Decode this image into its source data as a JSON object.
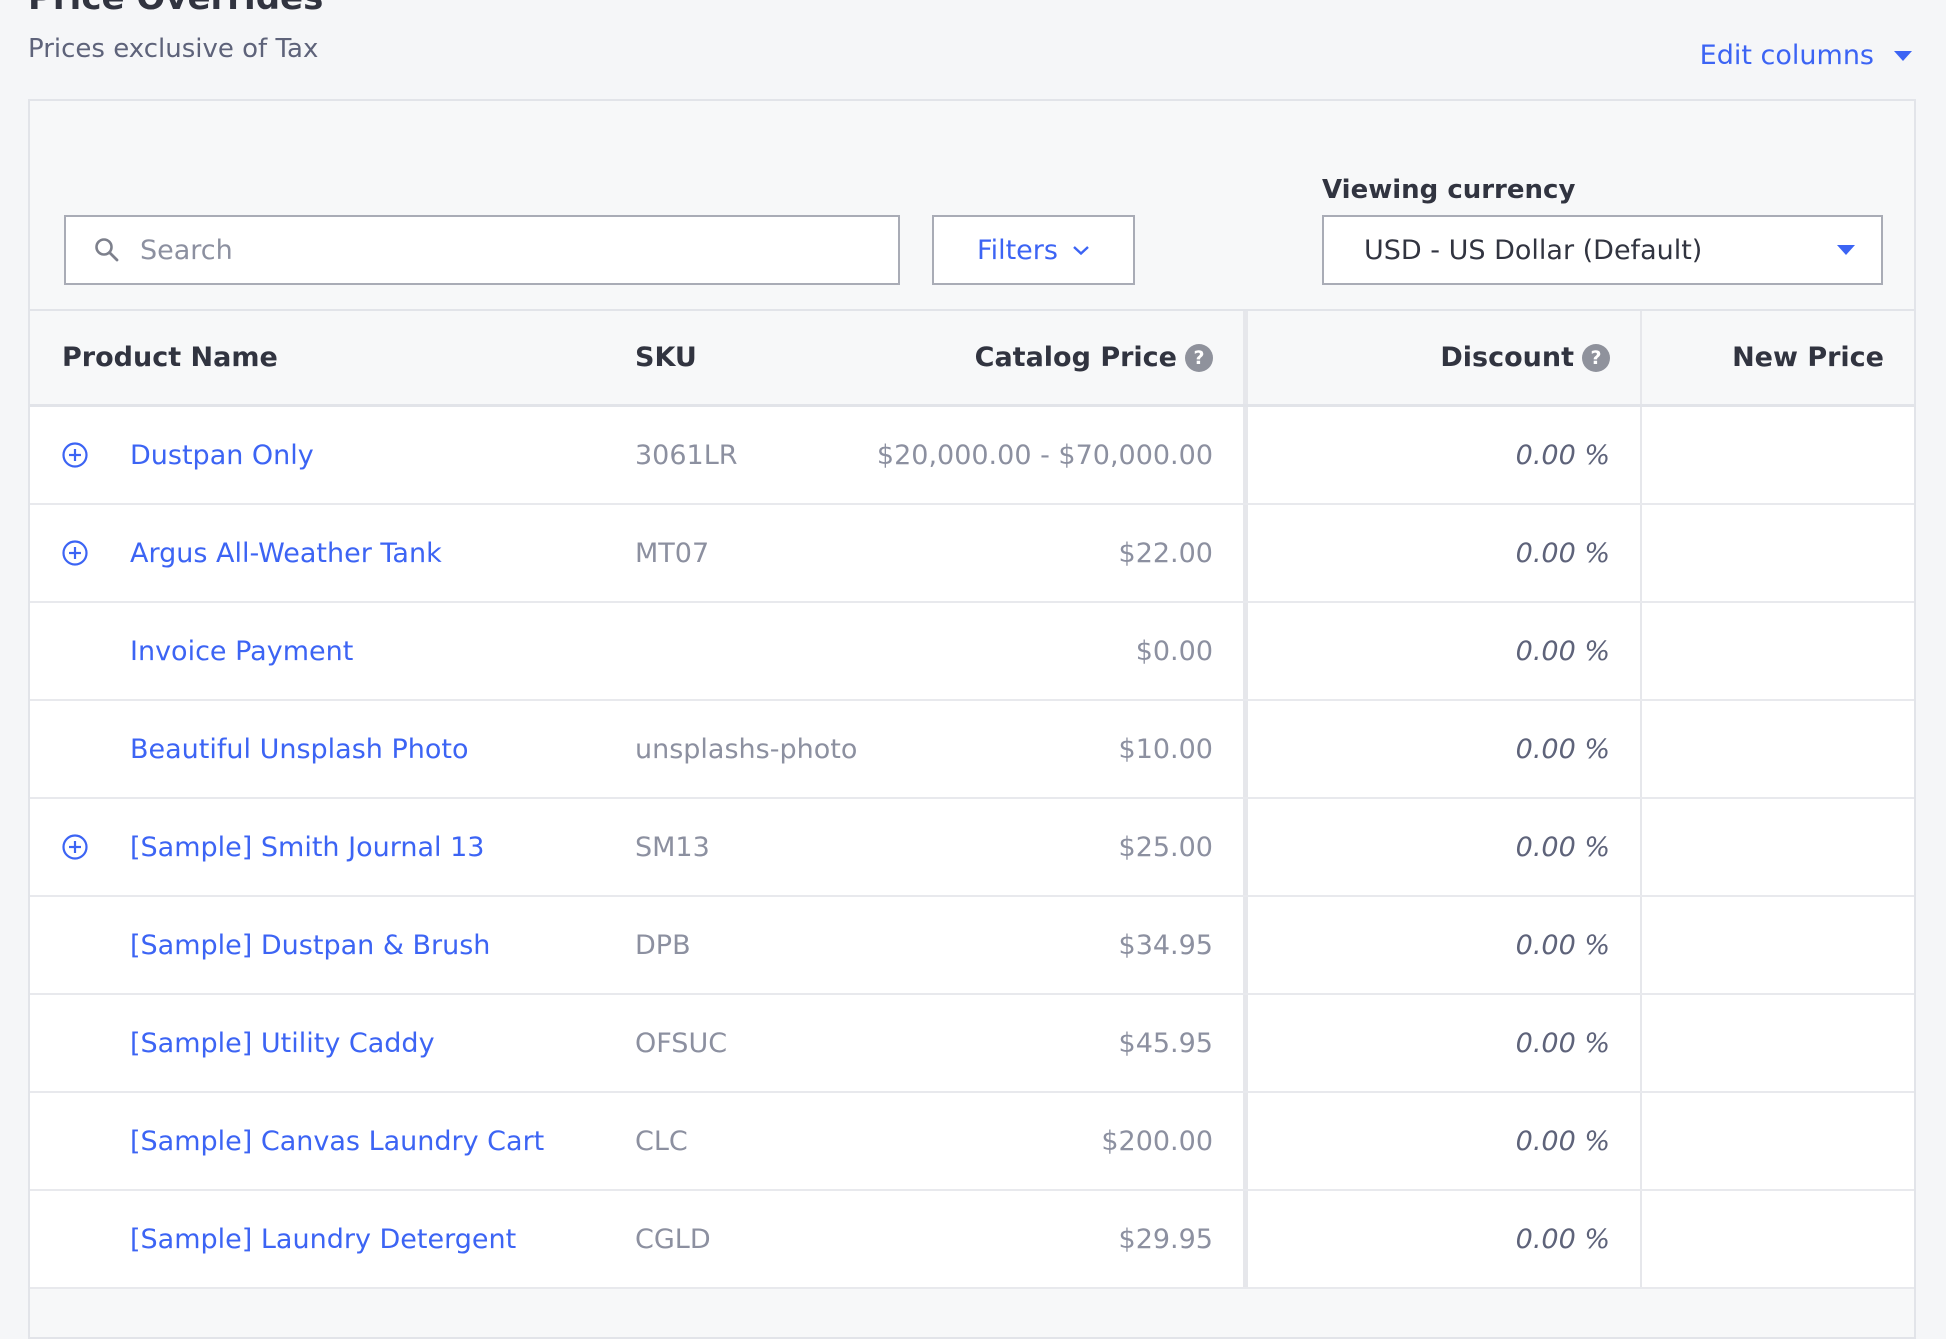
{
  "header": {
    "title": "Price Overrides",
    "subtitle": "Prices exclusive of Tax",
    "edit_columns_label": "Edit columns"
  },
  "toolbar": {
    "search_placeholder": "Search",
    "search_value": "",
    "filters_label": "Filters",
    "currency_label": "Viewing currency",
    "currency_selected": "USD - US Dollar (Default)"
  },
  "table": {
    "columns": {
      "name": "Product Name",
      "sku": "SKU",
      "catalog_price": "Catalog Price",
      "discount": "Discount",
      "new_price": "New Price"
    },
    "rows": [
      {
        "name": "Dustpan Only",
        "sku": "3061LR",
        "catalog_price": "$20,000.00 - $70,000.00",
        "discount": "0.00 %",
        "new_price": "",
        "expandable": true
      },
      {
        "name": "Argus All-Weather Tank",
        "sku": "MT07",
        "catalog_price": "$22.00",
        "discount": "0.00 %",
        "new_price": "",
        "expandable": true
      },
      {
        "name": "Invoice Payment",
        "sku": "",
        "catalog_price": "$0.00",
        "discount": "0.00 %",
        "new_price": "",
        "expandable": false
      },
      {
        "name": "Beautiful Unsplash Photo",
        "sku": "unsplashs-photo",
        "catalog_price": "$10.00",
        "discount": "0.00 %",
        "new_price": "",
        "expandable": false
      },
      {
        "name": "[Sample] Smith Journal 13",
        "sku": "SM13",
        "catalog_price": "$25.00",
        "discount": "0.00 %",
        "new_price": "",
        "expandable": true
      },
      {
        "name": "[Sample] Dustpan & Brush",
        "sku": "DPB",
        "catalog_price": "$34.95",
        "discount": "0.00 %",
        "new_price": "",
        "expandable": false
      },
      {
        "name": "[Sample] Utility Caddy",
        "sku": "OFSUC",
        "catalog_price": "$45.95",
        "discount": "0.00 %",
        "new_price": "",
        "expandable": false
      },
      {
        "name": "[Sample] Canvas Laundry Cart",
        "sku": "CLC",
        "catalog_price": "$200.00",
        "discount": "0.00 %",
        "new_price": "",
        "expandable": false
      },
      {
        "name": "[Sample] Laundry Detergent",
        "sku": "CGLD",
        "catalog_price": "$29.95",
        "discount": "0.00 %",
        "new_price": "",
        "expandable": false
      }
    ]
  },
  "colors": {
    "accent": "#3c64f4",
    "text": "#313440",
    "muted": "#8c90a0",
    "background": "#f5f6f8"
  },
  "icons": {
    "search": "search-icon",
    "filters_chevron": "chevron-down-icon",
    "currency_caret": "caret-down-icon",
    "help": "help-icon",
    "expand": "plus-circle-icon"
  }
}
